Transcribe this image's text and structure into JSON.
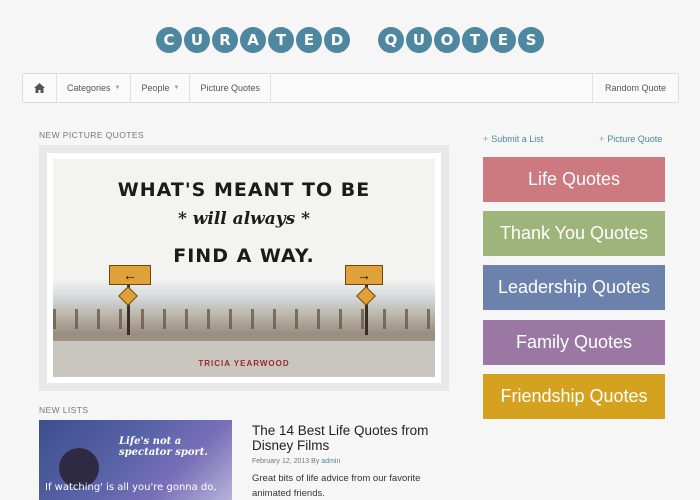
{
  "logo": {
    "word1": [
      "C",
      "U",
      "R",
      "A",
      "T",
      "E",
      "D"
    ],
    "word2": [
      "Q",
      "U",
      "O",
      "T",
      "E",
      "S"
    ]
  },
  "nav": {
    "home_icon": "home-icon",
    "items": [
      {
        "label": "Categories",
        "caret": "▼"
      },
      {
        "label": "People",
        "caret": "▼"
      },
      {
        "label": "Picture Quotes"
      }
    ],
    "random": "Random Quote"
  },
  "picture_section": {
    "heading": "New Picture Quotes",
    "quote_line1": "WHAT'S MEANT TO BE",
    "quote_line2": "* will always *",
    "quote_line3": "FIND A WAY.",
    "attribution": "TRICIA YEARWOOD"
  },
  "lists_section": {
    "heading": "New Lists",
    "thumb_text1": "Life's not a spectator sport.",
    "thumb_text2": "If watching' is all you're gonna do,",
    "title": "The 14 Best Life Quotes from Disney Films",
    "date": "February 12, 2013",
    "by": "By",
    "author": "admin",
    "description": "Great bits of life advice from our favorite animated friends."
  },
  "sidebar": {
    "submit_list": "Submit a List",
    "picture_quote": "Picture Quote",
    "plus": "+",
    "categories": [
      {
        "label": "Life Quotes",
        "color": "#cc7a80"
      },
      {
        "label": "Thank You Quotes",
        "color": "#9fb47a"
      },
      {
        "label": "Leadership  Quotes",
        "color": "#6c82ad"
      },
      {
        "label": "Family Quotes",
        "color": "#9a78a3"
      },
      {
        "label": "Friendship Quotes",
        "color": "#d4a21f"
      }
    ]
  }
}
